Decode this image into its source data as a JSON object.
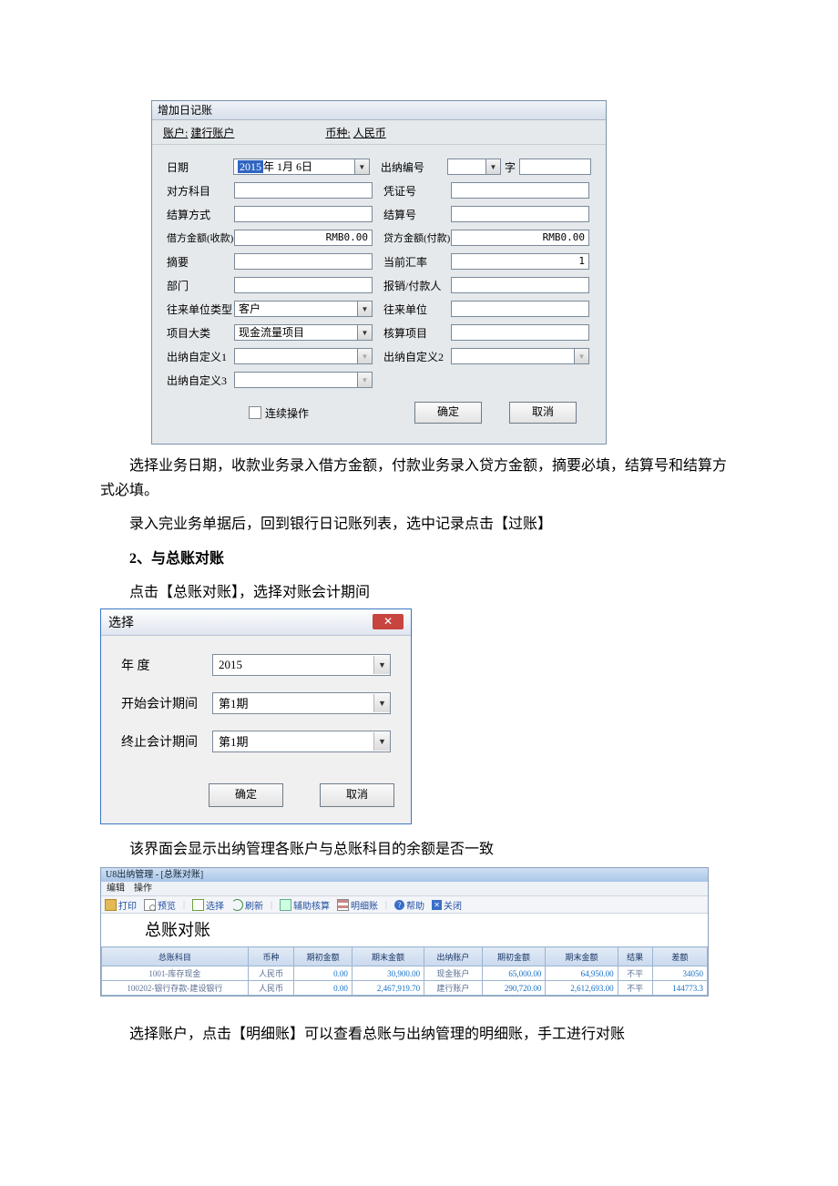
{
  "dialog1": {
    "title": "增加日记账",
    "header": {
      "account_label": "账户:",
      "account_value": "建行账户",
      "currency_label": "币种:",
      "currency_value": "人民币"
    },
    "left": {
      "date_label": "日期",
      "date_value": "2015年 1月 6日",
      "opp_subject_label": "对方科目",
      "settle_method_label": "结算方式",
      "debit_label": "借方金额(收款)",
      "debit_value": "RMB0.00",
      "summary_label": "摘要",
      "dept_label": "部门",
      "unit_type_label": "往来单位类型",
      "unit_type_value": "客户",
      "proj_cat_label": "项目大类",
      "proj_cat_value": "现金流量项目",
      "cust1_label": "出纳自定义1",
      "cust3_label": "出纳自定义3"
    },
    "right": {
      "cashier_no_label": "出纳编号",
      "cashier_no_suffix": "字",
      "voucher_no_label": "凭证号",
      "settle_no_label": "结算号",
      "credit_label": "贷方金额(付款)",
      "credit_value": "RMB0.00",
      "rate_label": "当前汇率",
      "rate_value": "1",
      "payee_label": "报销/付款人",
      "unit_label": "往来单位",
      "proj_label": "核算项目",
      "cust2_label": "出纳自定义2"
    },
    "footer": {
      "continuous_label": "连续操作",
      "ok": "确定",
      "cancel": "取消"
    }
  },
  "paragraphs": {
    "p1": "选择业务日期，收款业务录入借方金额，付款业务录入贷方金额，摘要必填，结算号和结算方式必填。",
    "p2": "录入完业务单据后，回到银行日记账列表，选中记录点击【过账】",
    "h2": "2、与总账对账",
    "p3": "点击【总账对账】，选择对账会计期间",
    "p4": "该界面会显示出纳管理各账户与总账科目的余额是否一致",
    "p5": "选择账户，点击【明细账】可以查看总账与出纳管理的明细账，手工进行对账"
  },
  "dialog2": {
    "title": "选择",
    "year_label": "年        度",
    "year_value": "2015",
    "start_label": "开始会计期间",
    "start_value": "第1期",
    "end_label": "终止会计期间",
    "end_value": "第1期",
    "ok": "确定",
    "cancel": "取消"
  },
  "app": {
    "title": "U8出纳管理 - [总账对账]",
    "menu": {
      "edit": "编辑",
      "op": "操作"
    },
    "toolbar": {
      "print": "打印",
      "preview": "预览",
      "select": "选择",
      "refresh": "刷新",
      "aux": "辅助核算",
      "detail": "明细账",
      "help": "帮助",
      "close": "关闭"
    },
    "heading": "总账对账",
    "columns": [
      "总账科目",
      "币种",
      "期初金额",
      "期末金额",
      "出纳账户",
      "期初金额",
      "期末金额",
      "结果",
      "差额"
    ],
    "rows": [
      {
        "subject": "1001-库存现金",
        "curr": "人民币",
        "qc": "0.00",
        "qm": "30,900.00",
        "acct": "现金账户",
        "cqc": "65,000.00",
        "cqm": "64,950.00",
        "res": "不平",
        "diff": "34050"
      },
      {
        "subject": "100202-银行存款-建设银行",
        "curr": "人民币",
        "qc": "0.00",
        "qm": "2,467,919.70",
        "acct": "建行账户",
        "cqc": "290,720.00",
        "cqm": "2,612,693.00",
        "res": "不平",
        "diff": "144773.3"
      }
    ]
  }
}
